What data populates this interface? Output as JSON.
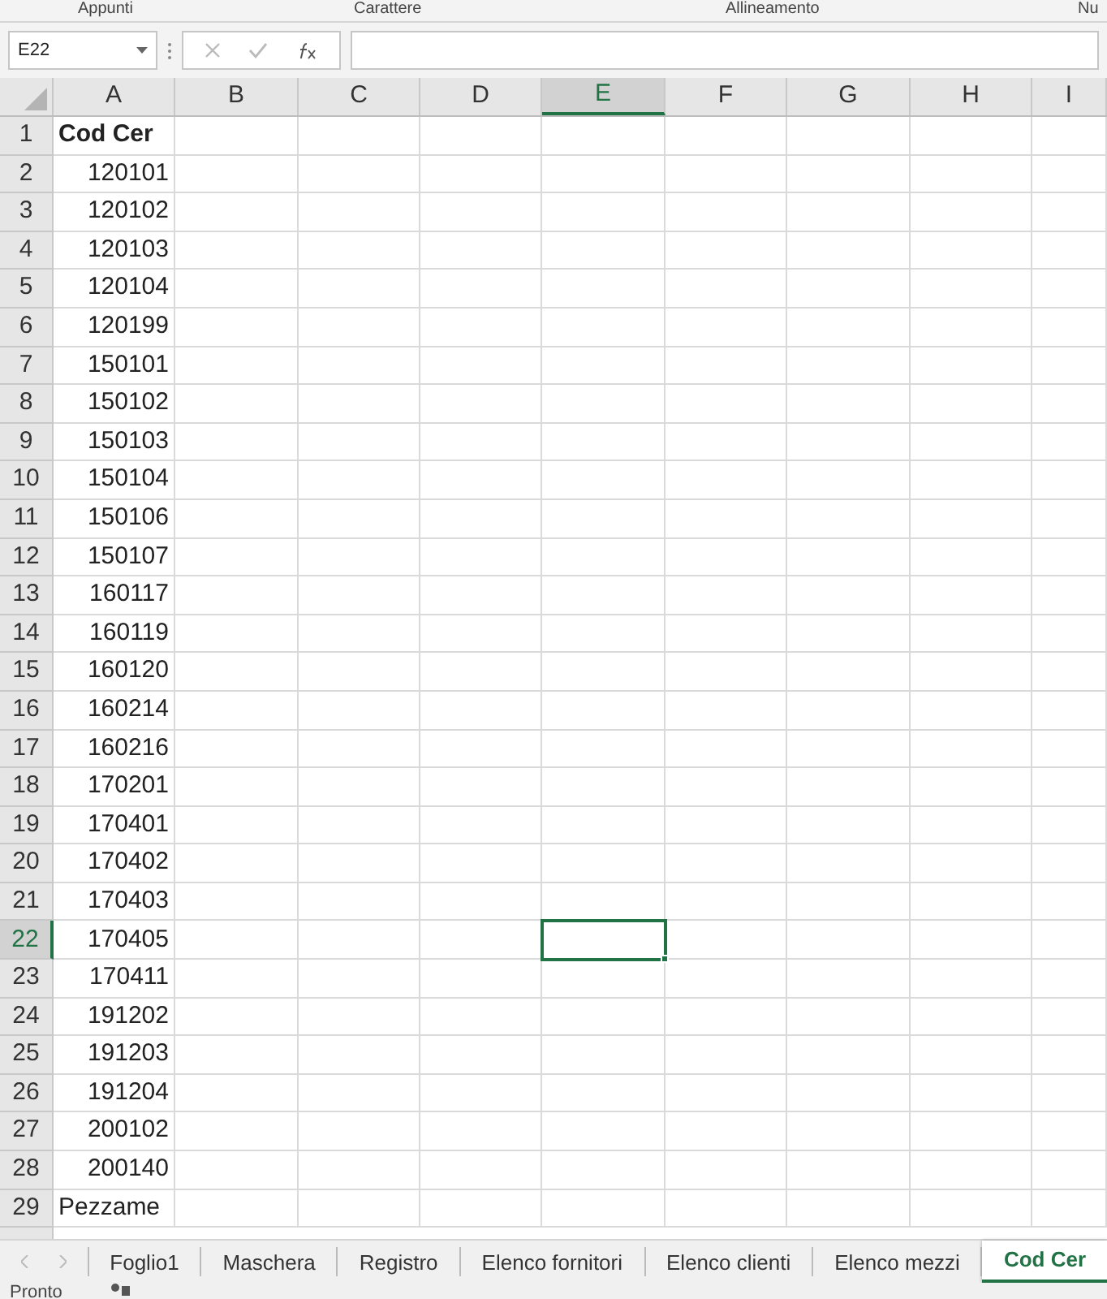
{
  "ribbon_groups": [
    "Appunti",
    "Carattere",
    "Allineamento",
    "Nu"
  ],
  "name_box": {
    "value": "E22"
  },
  "columns": [
    {
      "label": "A",
      "selected": false
    },
    {
      "label": "B",
      "selected": false
    },
    {
      "label": "C",
      "selected": false
    },
    {
      "label": "D",
      "selected": false
    },
    {
      "label": "E",
      "selected": true
    },
    {
      "label": "F",
      "selected": false
    },
    {
      "label": "G",
      "selected": false
    },
    {
      "label": "H",
      "selected": false
    },
    {
      "label": "I",
      "selected": false
    }
  ],
  "rows": [
    {
      "header": "1",
      "cell_a": "Cod Cer",
      "kind": "heading",
      "selected": false
    },
    {
      "header": "2",
      "cell_a": "120101",
      "kind": "number",
      "selected": false
    },
    {
      "header": "3",
      "cell_a": "120102",
      "kind": "number",
      "selected": false
    },
    {
      "header": "4",
      "cell_a": "120103",
      "kind": "number",
      "selected": false
    },
    {
      "header": "5",
      "cell_a": "120104",
      "kind": "number",
      "selected": false
    },
    {
      "header": "6",
      "cell_a": "120199",
      "kind": "number",
      "selected": false
    },
    {
      "header": "7",
      "cell_a": "150101",
      "kind": "number",
      "selected": false
    },
    {
      "header": "8",
      "cell_a": "150102",
      "kind": "number",
      "selected": false
    },
    {
      "header": "9",
      "cell_a": "150103",
      "kind": "number",
      "selected": false
    },
    {
      "header": "10",
      "cell_a": "150104",
      "kind": "number",
      "selected": false
    },
    {
      "header": "11",
      "cell_a": "150106",
      "kind": "number",
      "selected": false
    },
    {
      "header": "12",
      "cell_a": "150107",
      "kind": "number",
      "selected": false
    },
    {
      "header": "13",
      "cell_a": "160117",
      "kind": "number",
      "selected": false
    },
    {
      "header": "14",
      "cell_a": "160119",
      "kind": "number",
      "selected": false
    },
    {
      "header": "15",
      "cell_a": "160120",
      "kind": "number",
      "selected": false
    },
    {
      "header": "16",
      "cell_a": "160214",
      "kind": "number",
      "selected": false
    },
    {
      "header": "17",
      "cell_a": "160216",
      "kind": "number",
      "selected": false
    },
    {
      "header": "18",
      "cell_a": "170201",
      "kind": "number",
      "selected": false
    },
    {
      "header": "19",
      "cell_a": "170401",
      "kind": "number",
      "selected": false
    },
    {
      "header": "20",
      "cell_a": "170402",
      "kind": "number",
      "selected": false
    },
    {
      "header": "21",
      "cell_a": "170403",
      "kind": "number",
      "selected": false
    },
    {
      "header": "22",
      "cell_a": "170405",
      "kind": "number",
      "selected": true
    },
    {
      "header": "23",
      "cell_a": "170411",
      "kind": "number",
      "selected": false
    },
    {
      "header": "24",
      "cell_a": "191202",
      "kind": "number",
      "selected": false
    },
    {
      "header": "25",
      "cell_a": "191203",
      "kind": "number",
      "selected": false
    },
    {
      "header": "26",
      "cell_a": "191204",
      "kind": "number",
      "selected": false
    },
    {
      "header": "27",
      "cell_a": "200102",
      "kind": "number",
      "selected": false
    },
    {
      "header": "28",
      "cell_a": "200140",
      "kind": "number",
      "selected": false
    },
    {
      "header": "29",
      "cell_a": "Pezzame",
      "kind": "text",
      "selected": false
    }
  ],
  "sheet_tabs": [
    {
      "label": "Foglio1",
      "selected": false
    },
    {
      "label": "Maschera",
      "selected": false
    },
    {
      "label": "Registro",
      "selected": false
    },
    {
      "label": "Elenco fornitori",
      "selected": false
    },
    {
      "label": "Elenco clienti",
      "selected": false
    },
    {
      "label": "Elenco mezzi",
      "selected": false
    },
    {
      "label": "Cod Cer",
      "selected": true
    }
  ],
  "status_bar": {
    "text": "Pronto"
  }
}
